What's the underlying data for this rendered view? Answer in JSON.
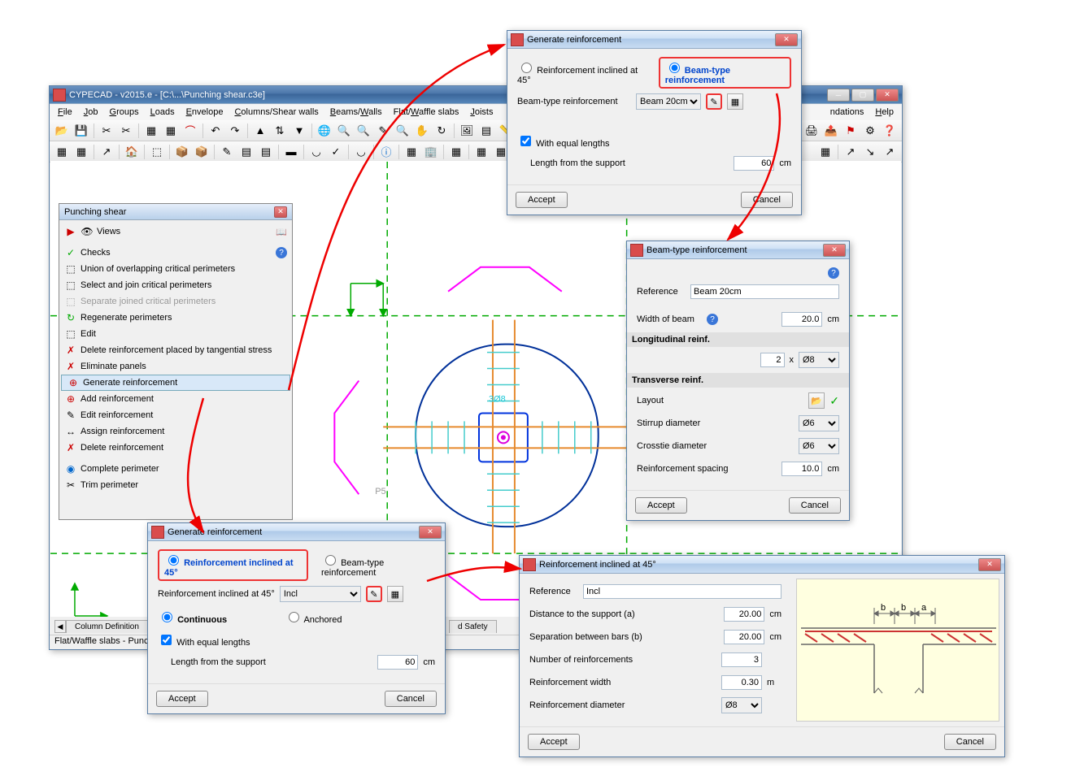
{
  "main_window": {
    "title": "CYPECAD - v2015.e - [C:\\...\\Punching shear.c3e]",
    "menu": [
      "File",
      "Job",
      "Groups",
      "Loads",
      "Envelope",
      "Columns/Shear walls",
      "Beams/Walls",
      "Flat/Waffle slabs",
      "Joists",
      "ndations",
      "Help"
    ],
    "tabs": [
      "Column Definition",
      "d Safety"
    ],
    "status": "Flat/Waffle slabs - Punci"
  },
  "side_panel": {
    "title": "Punching shear",
    "items": [
      {
        "icon": "▶",
        "icon2": "👁",
        "label": "Views"
      },
      {
        "icon": "✓",
        "label": "Checks"
      },
      {
        "icon": "⬚",
        "label": "Union of overlapping critical perimeters"
      },
      {
        "icon": "⬚",
        "label": "Select and join critical perimeters"
      },
      {
        "icon": "⬚",
        "label": "Separate joined critical perimeters",
        "disabled": true
      },
      {
        "icon": "↻",
        "label": "Regenerate perimeters"
      },
      {
        "icon": "⬚",
        "label": "Edit"
      },
      {
        "icon": "✗",
        "label": "Delete reinforcement placed by tangential stress"
      },
      {
        "icon": "✗",
        "label": "Eliminate panels"
      },
      {
        "icon": "⊕",
        "label": "Generate reinforcement",
        "selected": true
      },
      {
        "icon": "⊕",
        "label": "Add reinforcement"
      },
      {
        "icon": "✎",
        "label": "Edit reinforcement"
      },
      {
        "icon": "↔",
        "label": "Assign reinforcement"
      },
      {
        "icon": "✗",
        "label": "Delete reinforcement"
      },
      {
        "icon": "◉",
        "label": "Complete perimeter"
      },
      {
        "icon": "✂",
        "label": "Trim perimeter"
      }
    ]
  },
  "drawing": {
    "col_label": "P5",
    "annotation": "3Ø8"
  },
  "dlg_gen1": {
    "title": "Generate reinforcement",
    "opt45": "Reinforcement inclined at 45°",
    "optBeam": "Beam-type reinforcement",
    "beam_label": "Beam-type reinforcement",
    "beam_value": "Beam 20cm",
    "equal": "With equal lengths",
    "len_label": "Length from the support",
    "len_val": "60",
    "len_unit": "cm",
    "accept": "Accept",
    "cancel": "Cancel"
  },
  "dlg_beam": {
    "title": "Beam-type reinforcement",
    "ref_label": "Reference",
    "ref_val": "Beam 20cm",
    "width_label": "Width of beam",
    "width_val": "20.0",
    "width_unit": "cm",
    "long_header": "Longitudinal reinf.",
    "long_count": "2",
    "long_x": "x",
    "long_dia": "Ø8",
    "trans_header": "Transverse reinf.",
    "layout_label": "Layout",
    "stirrup_label": "Stirrup diameter",
    "stirrup_val": "Ø6",
    "crosstie_label": "Crosstie diameter",
    "crosstie_val": "Ø6",
    "spacing_label": "Reinforcement spacing",
    "spacing_val": "10.0",
    "spacing_unit": "cm",
    "accept": "Accept",
    "cancel": "Cancel"
  },
  "dlg_gen2": {
    "title": "Generate reinforcement",
    "opt45": "Reinforcement inclined at 45°",
    "optBeam": "Beam-type reinforcement",
    "incl_label": "Reinforcement inclined at 45°",
    "incl_val": "Incl",
    "cont": "Continuous",
    "anch": "Anchored",
    "equal": "With equal lengths",
    "len_label": "Length from the support",
    "len_val": "60",
    "len_unit": "cm",
    "accept": "Accept",
    "cancel": "Cancel"
  },
  "dlg_incl": {
    "title": "Reinforcement inclined at 45°",
    "ref_label": "Reference",
    "ref_val": "Incl",
    "dist_label": "Distance to the support (a)",
    "dist_val": "20.00",
    "dist_unit": "cm",
    "sep_label": "Separation between bars (b)",
    "sep_val": "20.00",
    "sep_unit": "cm",
    "num_label": "Number of reinforcements",
    "num_val": "3",
    "width_label": "Reinforcement width",
    "width_val": "0.30",
    "width_unit": "m",
    "dia_label": "Reinforcement diameter",
    "dia_val": "Ø8",
    "accept": "Accept",
    "cancel": "Cancel",
    "dim_b": "b",
    "dim_a": "a"
  }
}
